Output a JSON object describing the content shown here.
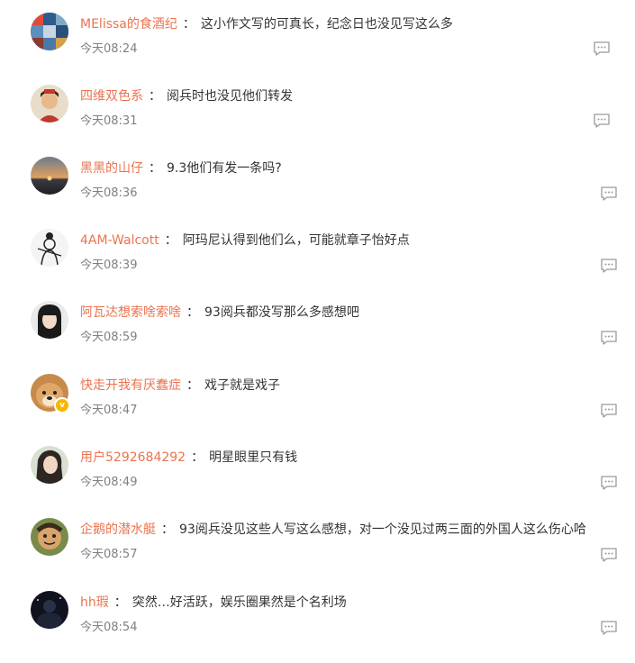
{
  "comments": [
    {
      "username": "MElissa的食酒纪",
      "colon": "：",
      "text": "这小作文写的可真长，纪念日也没见写这么多",
      "time": "今天08:24",
      "avatar_icon": "mosaic-avatar",
      "verified": false
    },
    {
      "username": "四维双色系",
      "colon": "：",
      "text": "阅兵时也没见他们转发",
      "time": "今天08:31",
      "avatar_icon": "portrait-avatar",
      "verified": false
    },
    {
      "username": "黑黑的山仔",
      "colon": "：",
      "text": "9.3他们有发一条吗?",
      "time": "今天08:36",
      "avatar_icon": "sunset-avatar",
      "verified": false
    },
    {
      "username": "4AM-Walcott",
      "colon": "：",
      "text": "阿玛尼认得到他们么，可能就章子怡好点",
      "time": "今天08:39",
      "avatar_icon": "sketch-avatar",
      "verified": false
    },
    {
      "username": "阿瓦达想索啥索啥",
      "colon": "：",
      "text": "93阅兵都没写那么多感想吧",
      "time": "今天08:59",
      "avatar_icon": "girl-avatar",
      "verified": false
    },
    {
      "username": "快走开我有厌蠢症",
      "colon": "：",
      "text": "戏子就是戏子",
      "time": "今天08:47",
      "avatar_icon": "dog-avatar",
      "verified": true,
      "verified_mark": "v"
    },
    {
      "username": "用户5292684292",
      "colon": "：",
      "text": "明星眼里只有钱",
      "time": "今天08:49",
      "avatar_icon": "woman-avatar",
      "verified": false
    },
    {
      "username": "企鹅的潜水艇",
      "colon": "：",
      "text": "93阅兵没见这些人写这么感想，对一个没见过两三面的外国人这么伤心哈",
      "time": "今天08:57",
      "avatar_icon": "cartoon-avatar",
      "verified": false
    },
    {
      "username": "hh瑕",
      "colon": "：",
      "text": "突然…好活跃，娱乐圈果然是个名利场",
      "time": "今天08:54",
      "avatar_icon": "night-avatar",
      "verified": false
    }
  ],
  "colors": {
    "username": "#eb7350",
    "text": "#333333",
    "time": "#808080",
    "icon": "#9a9a9a"
  }
}
